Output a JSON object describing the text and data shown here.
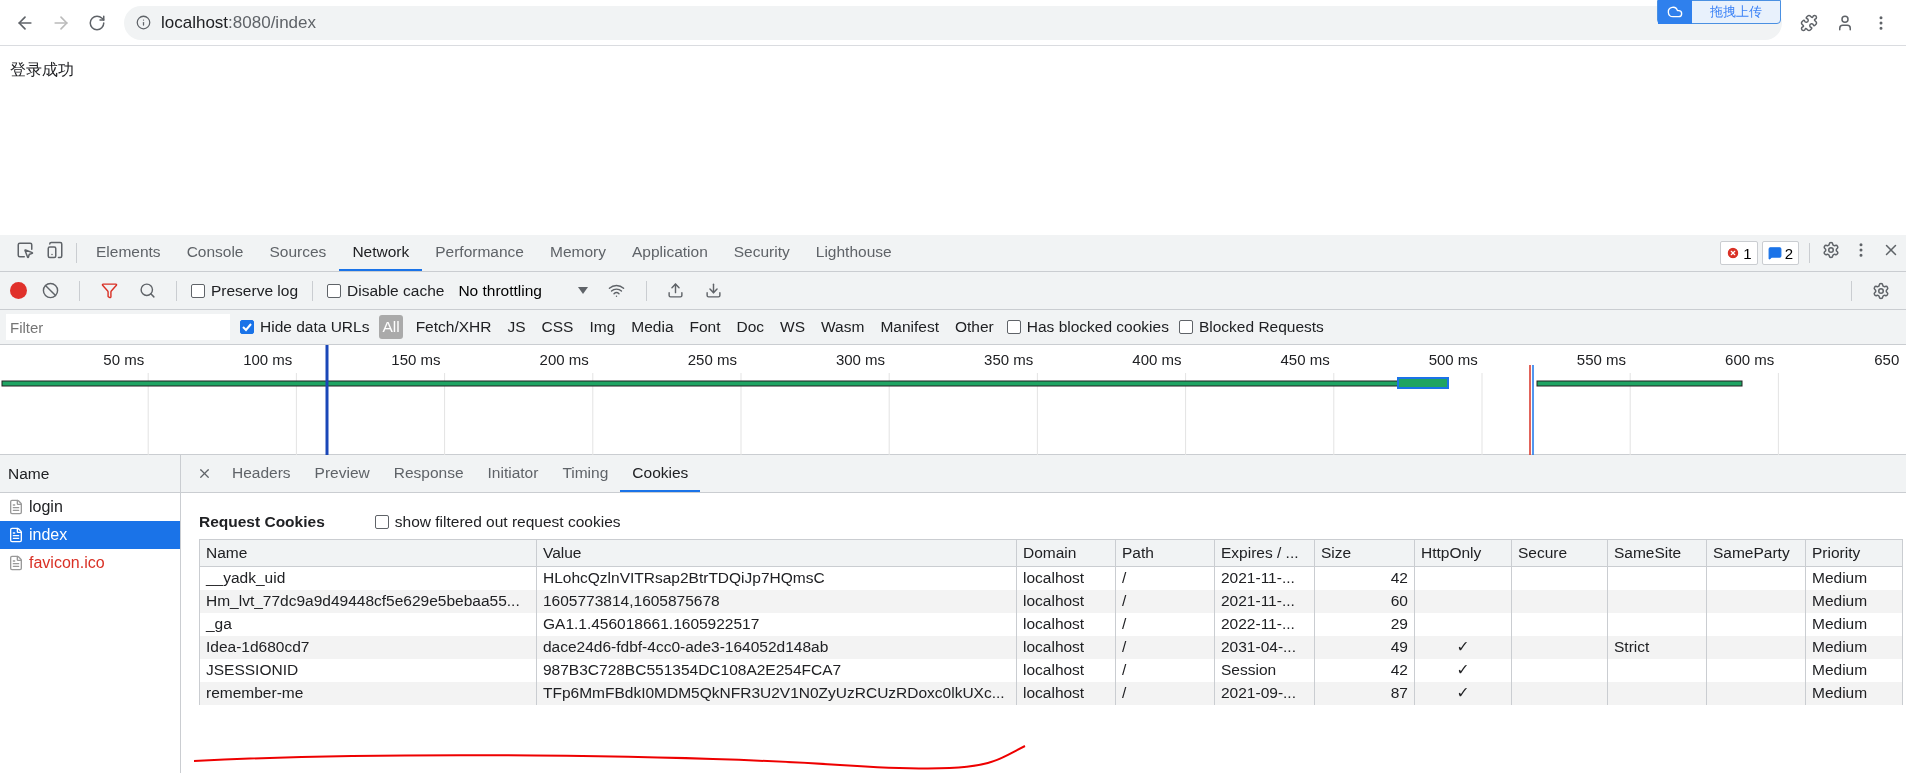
{
  "browser": {
    "url_host": "localhost",
    "url_rest": ":8080/index",
    "upload_widget": "拖拽上传"
  },
  "page": {
    "message": "登录成功"
  },
  "devtools": {
    "tabs": [
      {
        "label": "Elements",
        "selected": false
      },
      {
        "label": "Console",
        "selected": false
      },
      {
        "label": "Sources",
        "selected": false
      },
      {
        "label": "Network",
        "selected": true
      },
      {
        "label": "Performance",
        "selected": false
      },
      {
        "label": "Memory",
        "selected": false
      },
      {
        "label": "Application",
        "selected": false
      },
      {
        "label": "Security",
        "selected": false
      },
      {
        "label": "Lighthouse",
        "selected": false
      }
    ],
    "error_count": "1",
    "message_count": "2",
    "toolbar": {
      "preserve_log": {
        "label": "Preserve log",
        "checked": false
      },
      "disable_cache": {
        "label": "Disable cache",
        "checked": false
      },
      "throttling": "No throttling"
    },
    "filter": {
      "placeholder": "Filter",
      "hide_data_urls": {
        "label": "Hide data URLs",
        "checked": true
      },
      "types": [
        {
          "label": "All",
          "selected": true
        },
        {
          "label": "Fetch/XHR",
          "selected": false
        },
        {
          "label": "JS",
          "selected": false
        },
        {
          "label": "CSS",
          "selected": false
        },
        {
          "label": "Img",
          "selected": false
        },
        {
          "label": "Media",
          "selected": false
        },
        {
          "label": "Font",
          "selected": false
        },
        {
          "label": "Doc",
          "selected": false
        },
        {
          "label": "WS",
          "selected": false
        },
        {
          "label": "Wasm",
          "selected": false
        },
        {
          "label": "Manifest",
          "selected": false
        },
        {
          "label": "Other",
          "selected": false
        }
      ],
      "has_blocked_cookies": {
        "label": "Has blocked cookies",
        "checked": false
      },
      "blocked_requests": {
        "label": "Blocked Requests",
        "checked": false
      }
    },
    "timeline": {
      "ticks": [
        "50 ms",
        "100 ms",
        "150 ms",
        "200 ms",
        "250 ms",
        "300 ms",
        "350 ms",
        "400 ms",
        "450 ms",
        "500 ms",
        "550 ms",
        "600 ms",
        "650"
      ]
    },
    "requests": {
      "header": "Name",
      "items": [
        {
          "name": "login",
          "selected": false,
          "failed": false
        },
        {
          "name": "index",
          "selected": true,
          "failed": false
        },
        {
          "name": "favicon.ico",
          "selected": false,
          "failed": true
        }
      ]
    },
    "detail_tabs": [
      {
        "label": "Headers",
        "selected": false
      },
      {
        "label": "Preview",
        "selected": false
      },
      {
        "label": "Response",
        "selected": false
      },
      {
        "label": "Initiator",
        "selected": false
      },
      {
        "label": "Timing",
        "selected": false
      },
      {
        "label": "Cookies",
        "selected": true
      }
    ],
    "cookies": {
      "title": "Request Cookies",
      "show_filtered": {
        "label": "show filtered out request cookies",
        "checked": false
      },
      "columns": [
        "Name",
        "Value",
        "Domain",
        "Path",
        "Expires / ...",
        "Size",
        "HttpOnly",
        "Secure",
        "SameSite",
        "SameParty",
        "Priority"
      ],
      "rows": [
        {
          "cells": [
            "__yadk_uid",
            "HLohcQzlnVITRsap2BtrTDQiJp7HQmsC",
            "localhost",
            "/",
            "2021-11-...",
            "42",
            null,
            null,
            null,
            null,
            "Medium"
          ]
        },
        {
          "cells": [
            "Hm_lvt_77dc9a9d49448cf5e629e5bebaa55...",
            "1605773814,1605875678",
            "localhost",
            "/",
            "2021-11-...",
            "60",
            null,
            null,
            null,
            null,
            "Medium"
          ]
        },
        {
          "cells": [
            "_ga",
            "GA1.1.456018661.1605922517",
            "localhost",
            "/",
            "2022-11-...",
            "29",
            null,
            null,
            null,
            null,
            "Medium"
          ]
        },
        {
          "cells": [
            "Idea-1d680cd7",
            "dace24d6-fdbf-4cc0-ade3-164052d148ab",
            "localhost",
            "/",
            "2031-04-...",
            "49",
            "✓",
            null,
            "Strict",
            null,
            "Medium"
          ]
        },
        {
          "cells": [
            "JSESSIONID",
            "987B3C728BC551354DC108A2E254FCA7",
            "localhost",
            "/",
            "Session",
            "42",
            "✓",
            null,
            null,
            null,
            "Medium"
          ]
        },
        {
          "cells": [
            "remember-me",
            "TFp6MmFBdkI0MDM5QkNFR3U2V1N0ZyUzRCUzRDoxc0lkUXc...",
            "localhost",
            "/",
            "2021-09-...",
            "87",
            "✓",
            null,
            null,
            null,
            "Medium"
          ]
        }
      ]
    }
  }
}
